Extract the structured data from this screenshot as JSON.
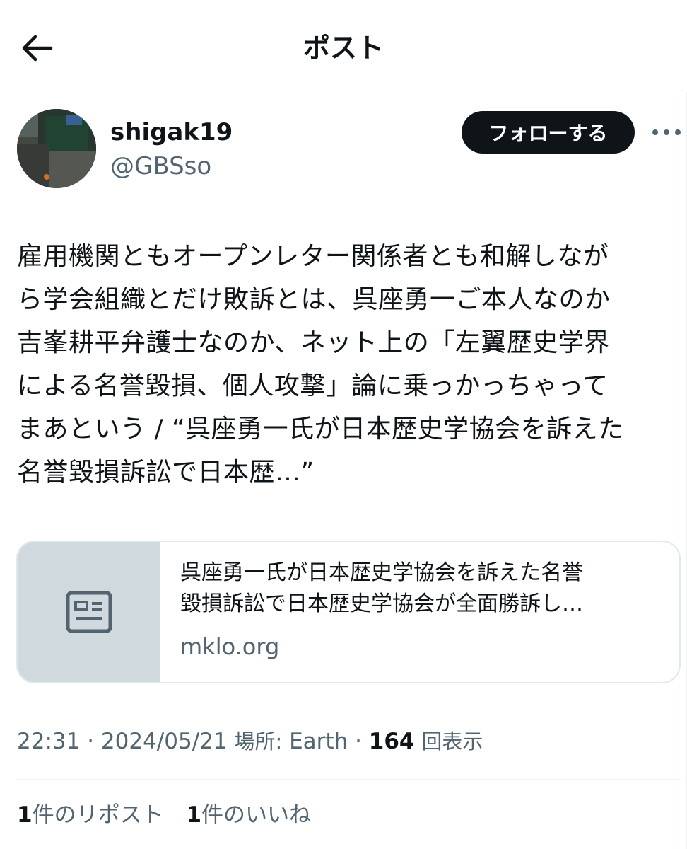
{
  "header": {
    "title": "ポスト",
    "back_icon": "arrow-left-icon"
  },
  "author": {
    "display_name": "shigak19",
    "handle": "@GBSso",
    "follow_label": "フォローする",
    "more_icon": "more-horizontal-icon"
  },
  "post": {
    "lines": [
      "雇用機関ともオープンレター関係者とも和解しなが",
      "ら学会組織とだけ敗訴とは、呉座勇一ご本人なのか",
      "吉峯耕平弁護士なのか、ネット上の「左翼歴史学界",
      "による名誉毀損、個人攻撃」論に乗っかっちゃって",
      "まあという / “呉座勇一氏が日本歴史学協会を訴えた",
      "名誉毀損訴訟で日本歴…”"
    ]
  },
  "link_card": {
    "thumb_icon": "article-icon",
    "title_line1": "呉座勇一氏が日本歴史学協会を訴えた名誉",
    "title_line2": "毀損訴訟で日本歴史学協会が全面勝訴し…",
    "domain": "mklo.org"
  },
  "meta": {
    "time": "22:31",
    "date": "2024/05/21",
    "location_label": "場所:",
    "location": "Earth",
    "views_count": "164",
    "views_label": "回表示",
    "sep": " · "
  },
  "stats": {
    "reposts_count": "1",
    "reposts_label": "件のリポスト",
    "likes_count": "1",
    "likes_label": "件のいいね"
  },
  "colors": {
    "text": "#0f1419",
    "secondary": "#536471",
    "card_thumb_bg": "#cfd9de",
    "border": "#e1e8ed"
  }
}
